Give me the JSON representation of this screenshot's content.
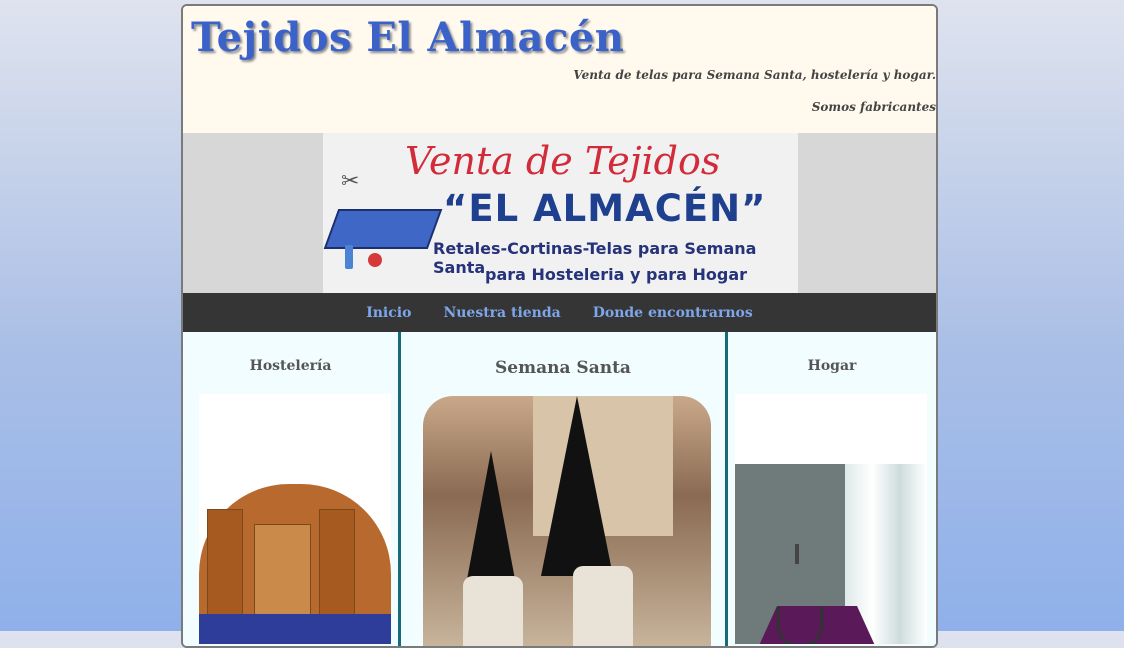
{
  "header": {
    "site_title": "Tejidos El Almacén",
    "tagline": "Venta de telas para Semana Santa, hostelería y hogar.",
    "subtagline": "Somos fabricantes"
  },
  "banner": {
    "line1": "Venta de Tejidos",
    "line2": "“EL ALMACÉN”",
    "line3": "Retales-Cortinas-Telas para Semana Santa",
    "line4": "para Hosteleria y para Hogar"
  },
  "nav": {
    "items": [
      {
        "label": "Inicio"
      },
      {
        "label": "Nuestra tienda"
      },
      {
        "label": "Donde encontrarnos"
      }
    ]
  },
  "columns": {
    "left": {
      "title": "Hostelería"
    },
    "middle": {
      "title": "Semana Santa"
    },
    "right": {
      "title": "Hogar"
    }
  },
  "colors": {
    "title": "#3a62c8",
    "nav_background": "#353535",
    "nav_link": "#7ea6ea",
    "column_divider": "#176a7a",
    "header_background": "#fff9ee"
  }
}
